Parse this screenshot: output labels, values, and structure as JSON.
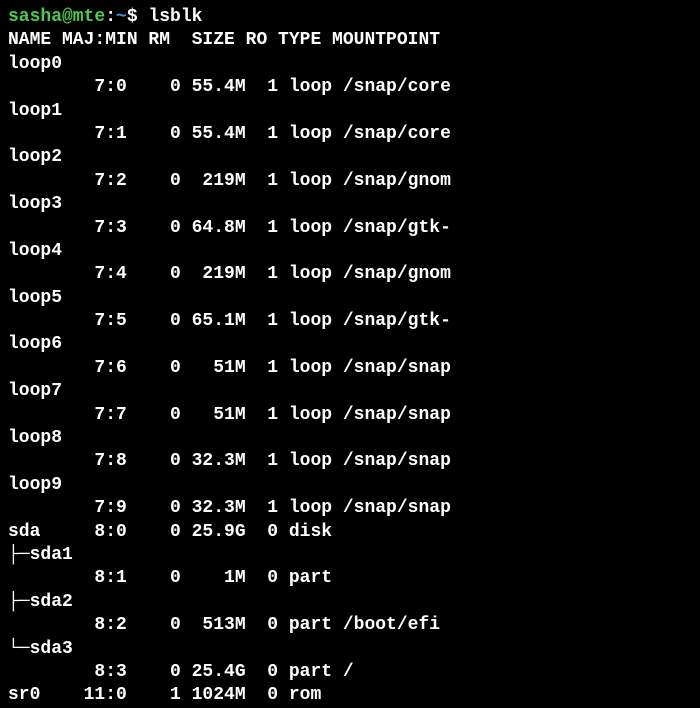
{
  "prompt": {
    "user_host": "sasha@mte",
    "sep1": ":",
    "path": "~",
    "sep2": "$ ",
    "command": "lsblk"
  },
  "header": "NAME MAJ:MIN RM  SIZE RO TYPE MOUNTPOINT",
  "rows": [
    "loop0",
    "        7:0    0 55.4M  1 loop /snap/core",
    "loop1",
    "        7:1    0 55.4M  1 loop /snap/core",
    "loop2",
    "        7:2    0  219M  1 loop /snap/gnom",
    "loop3",
    "        7:3    0 64.8M  1 loop /snap/gtk-",
    "loop4",
    "        7:4    0  219M  1 loop /snap/gnom",
    "loop5",
    "        7:5    0 65.1M  1 loop /snap/gtk-",
    "loop6",
    "        7:6    0   51M  1 loop /snap/snap",
    "loop7",
    "        7:7    0   51M  1 loop /snap/snap",
    "loop8",
    "        7:8    0 32.3M  1 loop /snap/snap",
    "loop9",
    "        7:9    0 32.3M  1 loop /snap/snap",
    "sda     8:0    0 25.9G  0 disk",
    "├─sda1",
    "        8:1    0    1M  0 part",
    "├─sda2",
    "        8:2    0  513M  0 part /boot/efi",
    "└─sda3",
    "        8:3    0 25.4G  0 part /",
    "sr0    11:0    1 1024M  0 rom"
  ]
}
